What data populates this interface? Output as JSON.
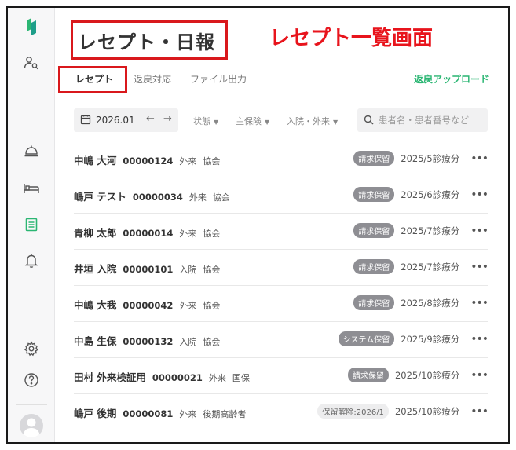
{
  "header": {
    "title": "レセプト・日報",
    "annotation": "レセプト一覧画面"
  },
  "tabs": [
    {
      "label": "レセプト",
      "active": true
    },
    {
      "label": "返戻対応",
      "active": false
    },
    {
      "label": "ファイル出力",
      "active": false
    }
  ],
  "upload_label": "返戻アップロード",
  "filters": {
    "date": "2026.01",
    "prev_arrow": "←",
    "next_arrow": "→",
    "status": "状態",
    "insurance": "主保険",
    "visit_type": "入院・外来",
    "search_placeholder": "患者名・患者番号など"
  },
  "rows": [
    {
      "name": "中嶋 大河",
      "id": "00000124",
      "type": "外来",
      "insurer": "協会",
      "badge": "請求保留",
      "period": "2025/5診療分"
    },
    {
      "name": "嶋戸 テスト",
      "id": "00000034",
      "type": "外来",
      "insurer": "協会",
      "badge": "請求保留",
      "period": "2025/6診療分"
    },
    {
      "name": "青柳 太郎",
      "id": "00000014",
      "type": "外来",
      "insurer": "協会",
      "badge": "請求保留",
      "period": "2025/7診療分"
    },
    {
      "name": "井垣 入院",
      "id": "00000101",
      "type": "入院",
      "insurer": "協会",
      "badge": "請求保留",
      "period": "2025/7診療分"
    },
    {
      "name": "中嶋 大我",
      "id": "00000042",
      "type": "外来",
      "insurer": "協会",
      "badge": "請求保留",
      "period": "2025/8診療分"
    },
    {
      "name": "中島 生保",
      "id": "00000132",
      "type": "入院",
      "insurer": "協会",
      "badge": "システム保留",
      "period": "2025/9診療分"
    },
    {
      "name": "田村 外来検証用",
      "id": "00000021",
      "type": "外来",
      "insurer": "国保",
      "badge": "請求保留",
      "period": "2025/10診療分"
    },
    {
      "name": "嶋戸 後期",
      "id": "00000081",
      "type": "外来",
      "insurer": "後期高齢者",
      "badge": "保留解除:2026/1",
      "period": "2025/10診療分"
    }
  ],
  "more_label": "•••",
  "colors": {
    "accent": "#2bb673",
    "annotation_red": "#e8141c",
    "badge_gray": "#8e8e93"
  }
}
